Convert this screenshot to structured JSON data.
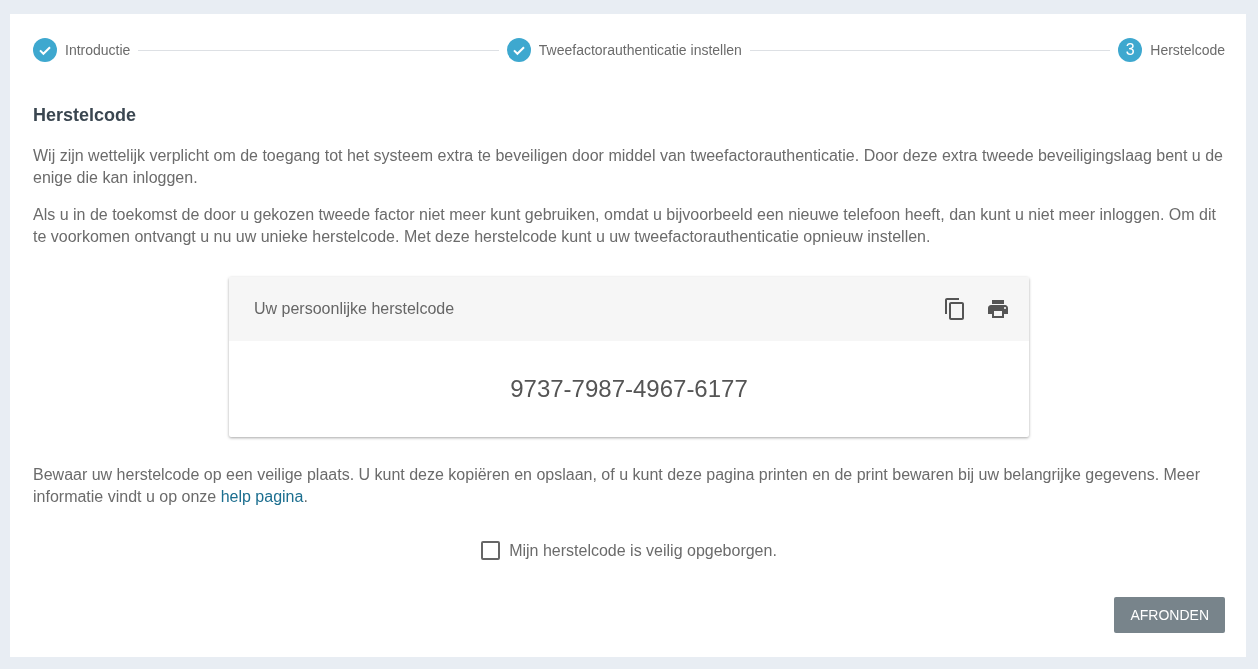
{
  "stepper": {
    "steps": [
      {
        "label": "Introductie",
        "completed": true
      },
      {
        "label": "Tweefactorauthenticatie instellen",
        "completed": true
      },
      {
        "label": "Herstelcode",
        "completed": false,
        "number": "3"
      }
    ]
  },
  "heading": "Herstelcode",
  "paragraphs": [
    "Wij zijn wettelijk verplicht om de toegang tot het systeem extra te beveiligen door middel van tweefactorauthenticatie. Door deze extra tweede beveiligingslaag bent u de enige die kan inloggen.",
    "Als u in de toekomst de door u gekozen tweede factor niet meer kunt gebruiken, omdat u bijvoorbeeld een nieuwe telefoon heeft, dan kunt u niet meer inloggen. Om dit te voorkomen ontvangt u nu uw unieke herstelcode. Met deze herstelcode kunt u uw tweefactorauthenticatie opnieuw instellen."
  ],
  "recovery_card": {
    "title": "Uw persoonlijke herstelcode",
    "code": "9737-7987-4967-6177"
  },
  "storage_note": {
    "text": "Bewaar uw herstelcode op een veilige plaats. U kunt deze kopiëren en opslaan, of u kunt deze pagina printen en de print bewaren bij uw belangrijke gegevens. Meer informatie vindt u op onze ",
    "link": "help pagina",
    "text_after": "."
  },
  "confirm_checkbox": {
    "label": "Mijn herstelcode is veilig opgeborgen.",
    "checked": false
  },
  "finish_button": {
    "label": "AFRONDEN"
  }
}
